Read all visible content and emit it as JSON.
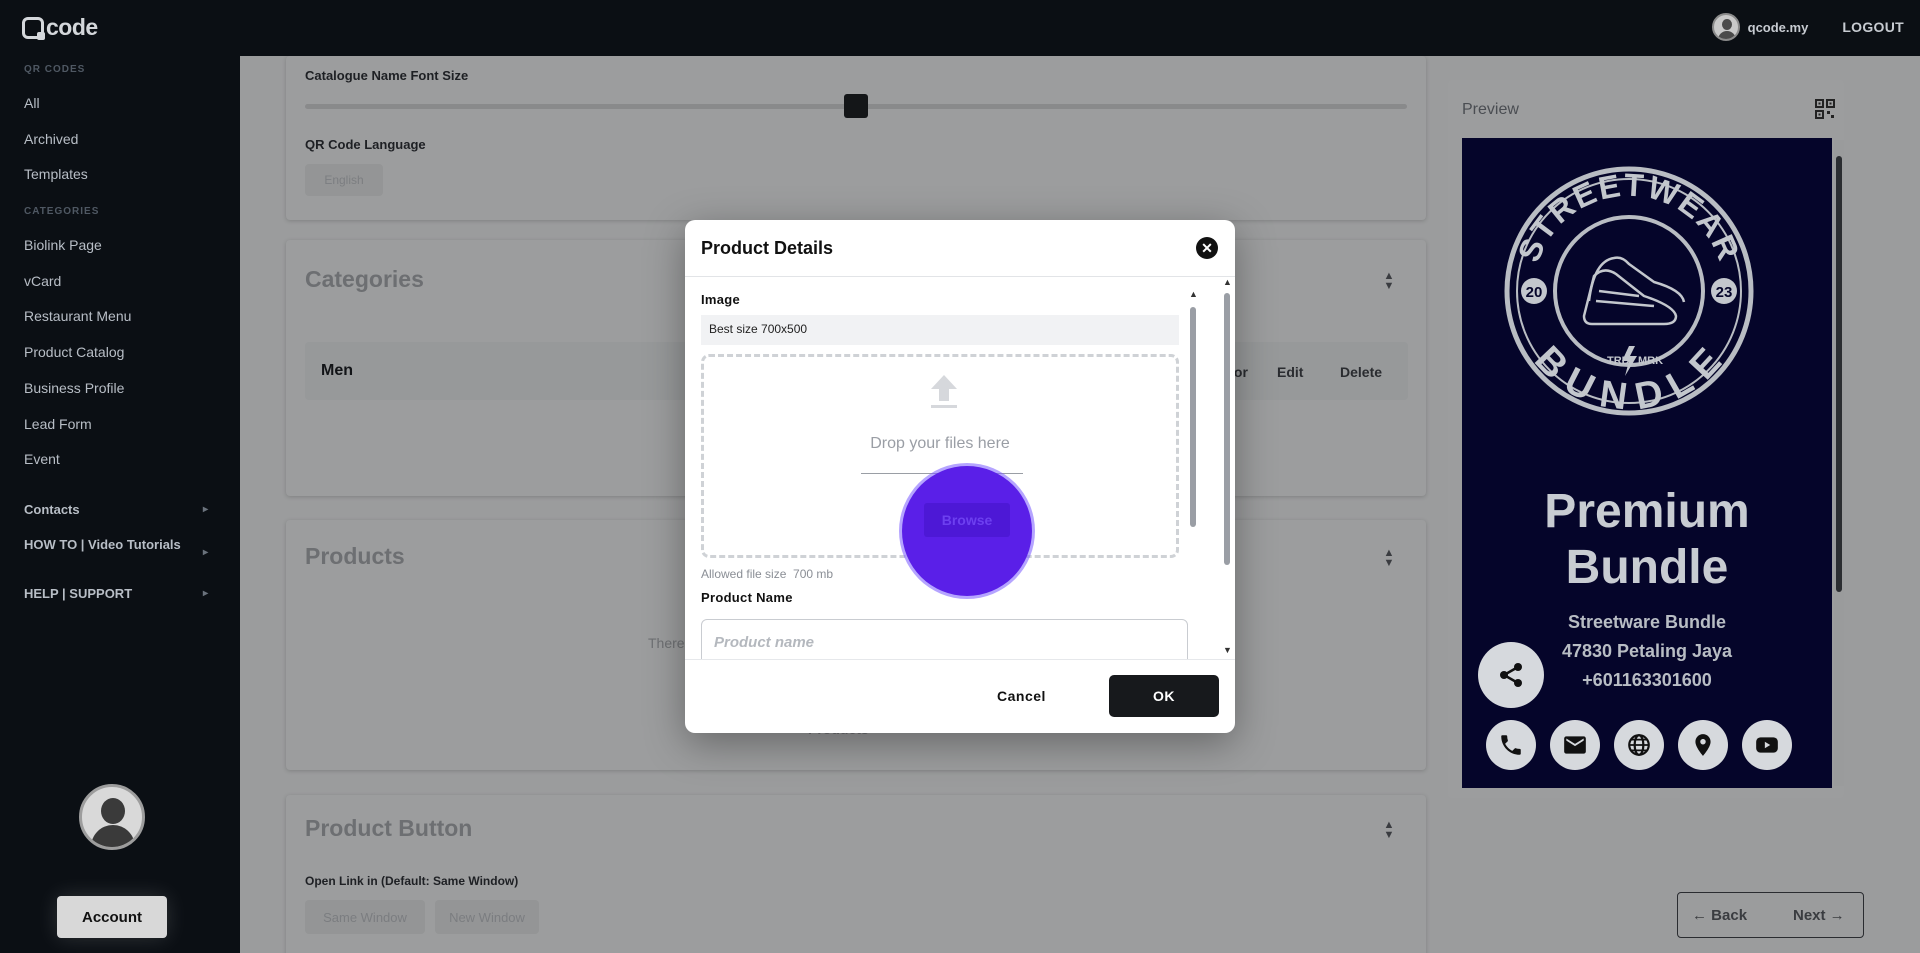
{
  "app": {
    "logo_text": "code",
    "user_name": "qcode.my",
    "logout_label": "LOGOUT"
  },
  "sidebar": {
    "qr_codes_heading": "QR CODES",
    "qr_items": [
      {
        "label": "All"
      },
      {
        "label": "Archived"
      },
      {
        "label": "Templates"
      }
    ],
    "categories_heading": "CATEGORIES",
    "category_items": [
      {
        "label": "Biolink Page"
      },
      {
        "label": "vCard"
      },
      {
        "label": "Restaurant Menu"
      },
      {
        "label": "Product Catalog"
      },
      {
        "label": "Business Profile"
      },
      {
        "label": "Lead Form"
      },
      {
        "label": "Event"
      }
    ],
    "expand_items": [
      {
        "label": "Contacts"
      },
      {
        "label": "HOW TO | Video Tutorials"
      },
      {
        "label": "HELP | SUPPORT"
      }
    ],
    "account_label": "Account"
  },
  "main": {
    "font_size_label": "Catalogue Name Font Size",
    "font_size_level": 0.5,
    "language_label": "QR Code Language",
    "language_value": "English",
    "categories_title": "Categories",
    "category_row": {
      "name": "Men",
      "color_action": "lor",
      "edit_label": "Edit",
      "delete_label": "Delete"
    },
    "products_title": "Products",
    "products_empty_partial": "There",
    "products_add_partial": "Products",
    "product_button_title": "Product Button",
    "open_link_label": "Open Link in (Default: Same Window)",
    "open_link_options": [
      "Same Window",
      "New Window"
    ],
    "back_label": "Back",
    "next_label": "Next"
  },
  "preview": {
    "title": "Preview",
    "badge_top_text": "STREETWEAR",
    "badge_bottom_text": "BUNDLE",
    "badge_left_year": "20",
    "badge_right_year": "23",
    "badge_left_mark": "TRD",
    "badge_right_mark": "MRK",
    "headline_line1": "Premium",
    "headline_line2": "Bundle",
    "sub_line1": "Streetware Bundle",
    "sub_line2": "47830 Petaling Jaya",
    "sub_line3": "+601163301600",
    "bg_color": "#05052a"
  },
  "modal": {
    "title": "Product Details",
    "image_label": "Image",
    "image_hint": "Best size 700x500",
    "drop_text": "Drop your files here",
    "browse_label": "Browse",
    "allowed_text": "Allowed file size",
    "allowed_size": "700 mb",
    "product_name_label": "Product Name",
    "product_name_placeholder": "Product name",
    "cancel_label": "Cancel",
    "ok_label": "OK",
    "browse_color": "#5a1fe8"
  }
}
